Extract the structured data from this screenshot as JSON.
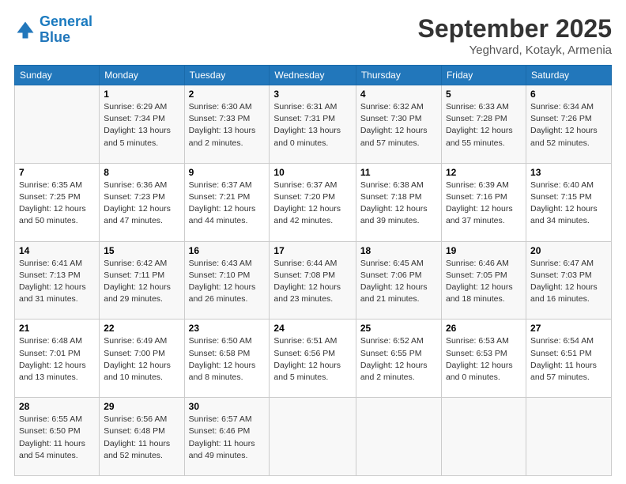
{
  "logo": {
    "line1": "General",
    "line2": "Blue"
  },
  "header": {
    "month": "September 2025",
    "location": "Yeghvard, Kotayk, Armenia"
  },
  "weekdays": [
    "Sunday",
    "Monday",
    "Tuesday",
    "Wednesday",
    "Thursday",
    "Friday",
    "Saturday"
  ],
  "weeks": [
    [
      {
        "day": "",
        "info": ""
      },
      {
        "day": "1",
        "info": "Sunrise: 6:29 AM\nSunset: 7:34 PM\nDaylight: 13 hours\nand 5 minutes."
      },
      {
        "day": "2",
        "info": "Sunrise: 6:30 AM\nSunset: 7:33 PM\nDaylight: 13 hours\nand 2 minutes."
      },
      {
        "day": "3",
        "info": "Sunrise: 6:31 AM\nSunset: 7:31 PM\nDaylight: 13 hours\nand 0 minutes."
      },
      {
        "day": "4",
        "info": "Sunrise: 6:32 AM\nSunset: 7:30 PM\nDaylight: 12 hours\nand 57 minutes."
      },
      {
        "day": "5",
        "info": "Sunrise: 6:33 AM\nSunset: 7:28 PM\nDaylight: 12 hours\nand 55 minutes."
      },
      {
        "day": "6",
        "info": "Sunrise: 6:34 AM\nSunset: 7:26 PM\nDaylight: 12 hours\nand 52 minutes."
      }
    ],
    [
      {
        "day": "7",
        "info": "Sunrise: 6:35 AM\nSunset: 7:25 PM\nDaylight: 12 hours\nand 50 minutes."
      },
      {
        "day": "8",
        "info": "Sunrise: 6:36 AM\nSunset: 7:23 PM\nDaylight: 12 hours\nand 47 minutes."
      },
      {
        "day": "9",
        "info": "Sunrise: 6:37 AM\nSunset: 7:21 PM\nDaylight: 12 hours\nand 44 minutes."
      },
      {
        "day": "10",
        "info": "Sunrise: 6:37 AM\nSunset: 7:20 PM\nDaylight: 12 hours\nand 42 minutes."
      },
      {
        "day": "11",
        "info": "Sunrise: 6:38 AM\nSunset: 7:18 PM\nDaylight: 12 hours\nand 39 minutes."
      },
      {
        "day": "12",
        "info": "Sunrise: 6:39 AM\nSunset: 7:16 PM\nDaylight: 12 hours\nand 37 minutes."
      },
      {
        "day": "13",
        "info": "Sunrise: 6:40 AM\nSunset: 7:15 PM\nDaylight: 12 hours\nand 34 minutes."
      }
    ],
    [
      {
        "day": "14",
        "info": "Sunrise: 6:41 AM\nSunset: 7:13 PM\nDaylight: 12 hours\nand 31 minutes."
      },
      {
        "day": "15",
        "info": "Sunrise: 6:42 AM\nSunset: 7:11 PM\nDaylight: 12 hours\nand 29 minutes."
      },
      {
        "day": "16",
        "info": "Sunrise: 6:43 AM\nSunset: 7:10 PM\nDaylight: 12 hours\nand 26 minutes."
      },
      {
        "day": "17",
        "info": "Sunrise: 6:44 AM\nSunset: 7:08 PM\nDaylight: 12 hours\nand 23 minutes."
      },
      {
        "day": "18",
        "info": "Sunrise: 6:45 AM\nSunset: 7:06 PM\nDaylight: 12 hours\nand 21 minutes."
      },
      {
        "day": "19",
        "info": "Sunrise: 6:46 AM\nSunset: 7:05 PM\nDaylight: 12 hours\nand 18 minutes."
      },
      {
        "day": "20",
        "info": "Sunrise: 6:47 AM\nSunset: 7:03 PM\nDaylight: 12 hours\nand 16 minutes."
      }
    ],
    [
      {
        "day": "21",
        "info": "Sunrise: 6:48 AM\nSunset: 7:01 PM\nDaylight: 12 hours\nand 13 minutes."
      },
      {
        "day": "22",
        "info": "Sunrise: 6:49 AM\nSunset: 7:00 PM\nDaylight: 12 hours\nand 10 minutes."
      },
      {
        "day": "23",
        "info": "Sunrise: 6:50 AM\nSunset: 6:58 PM\nDaylight: 12 hours\nand 8 minutes."
      },
      {
        "day": "24",
        "info": "Sunrise: 6:51 AM\nSunset: 6:56 PM\nDaylight: 12 hours\nand 5 minutes."
      },
      {
        "day": "25",
        "info": "Sunrise: 6:52 AM\nSunset: 6:55 PM\nDaylight: 12 hours\nand 2 minutes."
      },
      {
        "day": "26",
        "info": "Sunrise: 6:53 AM\nSunset: 6:53 PM\nDaylight: 12 hours\nand 0 minutes."
      },
      {
        "day": "27",
        "info": "Sunrise: 6:54 AM\nSunset: 6:51 PM\nDaylight: 11 hours\nand 57 minutes."
      }
    ],
    [
      {
        "day": "28",
        "info": "Sunrise: 6:55 AM\nSunset: 6:50 PM\nDaylight: 11 hours\nand 54 minutes."
      },
      {
        "day": "29",
        "info": "Sunrise: 6:56 AM\nSunset: 6:48 PM\nDaylight: 11 hours\nand 52 minutes."
      },
      {
        "day": "30",
        "info": "Sunrise: 6:57 AM\nSunset: 6:46 PM\nDaylight: 11 hours\nand 49 minutes."
      },
      {
        "day": "",
        "info": ""
      },
      {
        "day": "",
        "info": ""
      },
      {
        "day": "",
        "info": ""
      },
      {
        "day": "",
        "info": ""
      }
    ]
  ]
}
